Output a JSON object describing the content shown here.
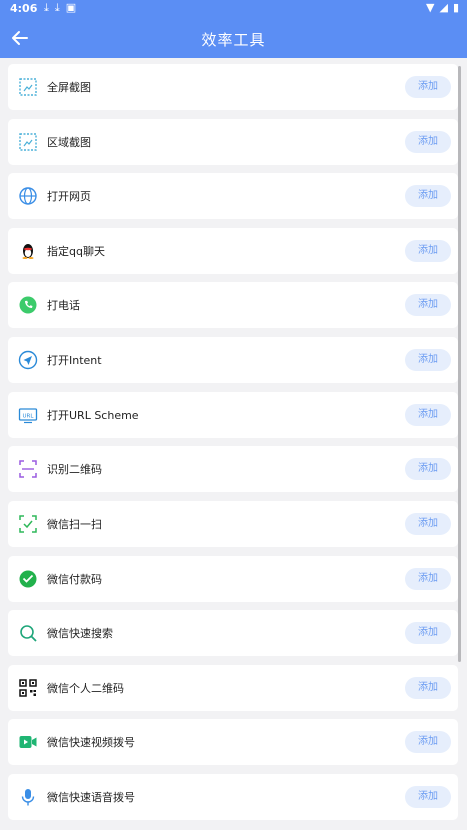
{
  "status_bar": {
    "time": "4:06"
  },
  "app_bar": {
    "title": "效率工具"
  },
  "add_label": "添加",
  "items": [
    {
      "label": "全屏截图",
      "icon": "fullscreen-screenshot-icon"
    },
    {
      "label": "区域截图",
      "icon": "area-screenshot-icon"
    },
    {
      "label": "打开网页",
      "icon": "globe-icon"
    },
    {
      "label": "指定qq聊天",
      "icon": "qq-penguin-icon"
    },
    {
      "label": "打电话",
      "icon": "phone-icon"
    },
    {
      "label": "打开Intent",
      "icon": "send-arrow-icon"
    },
    {
      "label": "打开URL Scheme",
      "icon": "url-icon"
    },
    {
      "label": "识别二维码",
      "icon": "scan-frame-icon"
    },
    {
      "label": "微信扫一扫",
      "icon": "wechat-scan-icon"
    },
    {
      "label": "微信付款码",
      "icon": "wechat-pay-icon"
    },
    {
      "label": "微信快速搜索",
      "icon": "search-icon"
    },
    {
      "label": "微信个人二维码",
      "icon": "qr-code-icon"
    },
    {
      "label": "微信快速视频拨号",
      "icon": "video-call-icon"
    },
    {
      "label": "微信快速语音拨号",
      "icon": "microphone-icon"
    }
  ],
  "colors": {
    "accent": "#5b8ef4",
    "button_bg": "#e6eefc",
    "button_text": "#6c9cf2"
  }
}
